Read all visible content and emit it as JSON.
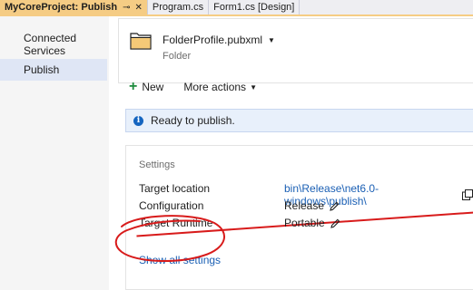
{
  "tabs": [
    {
      "label": "MyCoreProject: Publish",
      "active": true,
      "pin": "⊸",
      "close": "✕"
    },
    {
      "label": "Program.cs",
      "active": false
    },
    {
      "label": "Form1.cs [Design]",
      "active": false
    }
  ],
  "sidebar": {
    "items": [
      {
        "label": "Connected Services",
        "selected": false
      },
      {
        "label": "Publish",
        "selected": true
      }
    ]
  },
  "profile": {
    "name": "FolderProfile.pubxml",
    "type": "Folder",
    "caret": "▼"
  },
  "toolbar": {
    "new_label": "New",
    "more_label": "More actions",
    "plus": "+",
    "caret": "▼"
  },
  "info": {
    "icon": "i",
    "text": "Ready to publish."
  },
  "settings": {
    "title": "Settings",
    "rows": [
      {
        "label": "Target location",
        "value": "bin\\Release\\net6.0-windows\\publish\\",
        "action": "copy-icon"
      },
      {
        "label": "Configuration",
        "value": "Release",
        "action": "pencil-icon"
      },
      {
        "label": "Target Runtime",
        "value": "Portable",
        "action": "pencil-icon"
      }
    ],
    "show_all": "Show all settings"
  },
  "colors": {
    "accent": "#1a5fb4",
    "active_tab": "#f5cc84",
    "annotation": "#d81b1b"
  }
}
